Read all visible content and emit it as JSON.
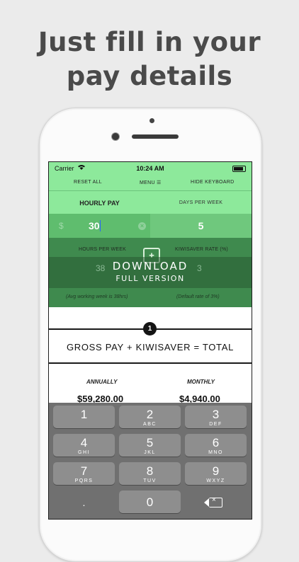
{
  "headline": {
    "line1": "Just fill in your",
    "line2": "pay details"
  },
  "statusbar": {
    "carrier": "Carrier",
    "time": "10:24 AM"
  },
  "toolbar": {
    "reset_label": "RESET ALL",
    "menu_label": "MENU ☰",
    "hide_keyboard_label": "HIDE KEYBOARD"
  },
  "fields": {
    "hourly_pay_label": "HOURLY PAY",
    "hourly_pay_currency": "$",
    "hourly_pay_value": "30",
    "days_per_week_label": "DAYS PER WEEK",
    "days_per_week_value": "5",
    "hours_per_week_label": "HOURS PER WEEK",
    "hours_per_week_value": "38",
    "hours_per_week_note": "(Avg working week is 38hrs)",
    "kiwisaver_label": "KIWISAVER RATE (%)",
    "kiwisaver_value": "3",
    "kiwisaver_note": "(Default rate of 3%)"
  },
  "download": {
    "line1": "DOWNLOAD",
    "line2": "FULL VERSION"
  },
  "results": {
    "step_number": "1",
    "formula": "GROSS PAY + KIWISAVER = TOTAL",
    "annually_label": "ANNUALLY",
    "annually_value": "$59,280.00",
    "monthly_label": "MONTHLY",
    "monthly_value": "$4,940.00"
  },
  "keyboard": {
    "keys": [
      {
        "num": "1",
        "letters": ""
      },
      {
        "num": "2",
        "letters": "ABC"
      },
      {
        "num": "3",
        "letters": "DEF"
      },
      {
        "num": "4",
        "letters": "GHI"
      },
      {
        "num": "5",
        "letters": "JKL"
      },
      {
        "num": "6",
        "letters": "MNO"
      },
      {
        "num": "7",
        "letters": "PQRS"
      },
      {
        "num": "8",
        "letters": "TUV"
      },
      {
        "num": "9",
        "letters": "WXYZ"
      },
      {
        "num": ".",
        "letters": ""
      },
      {
        "num": "0",
        "letters": ""
      }
    ]
  }
}
